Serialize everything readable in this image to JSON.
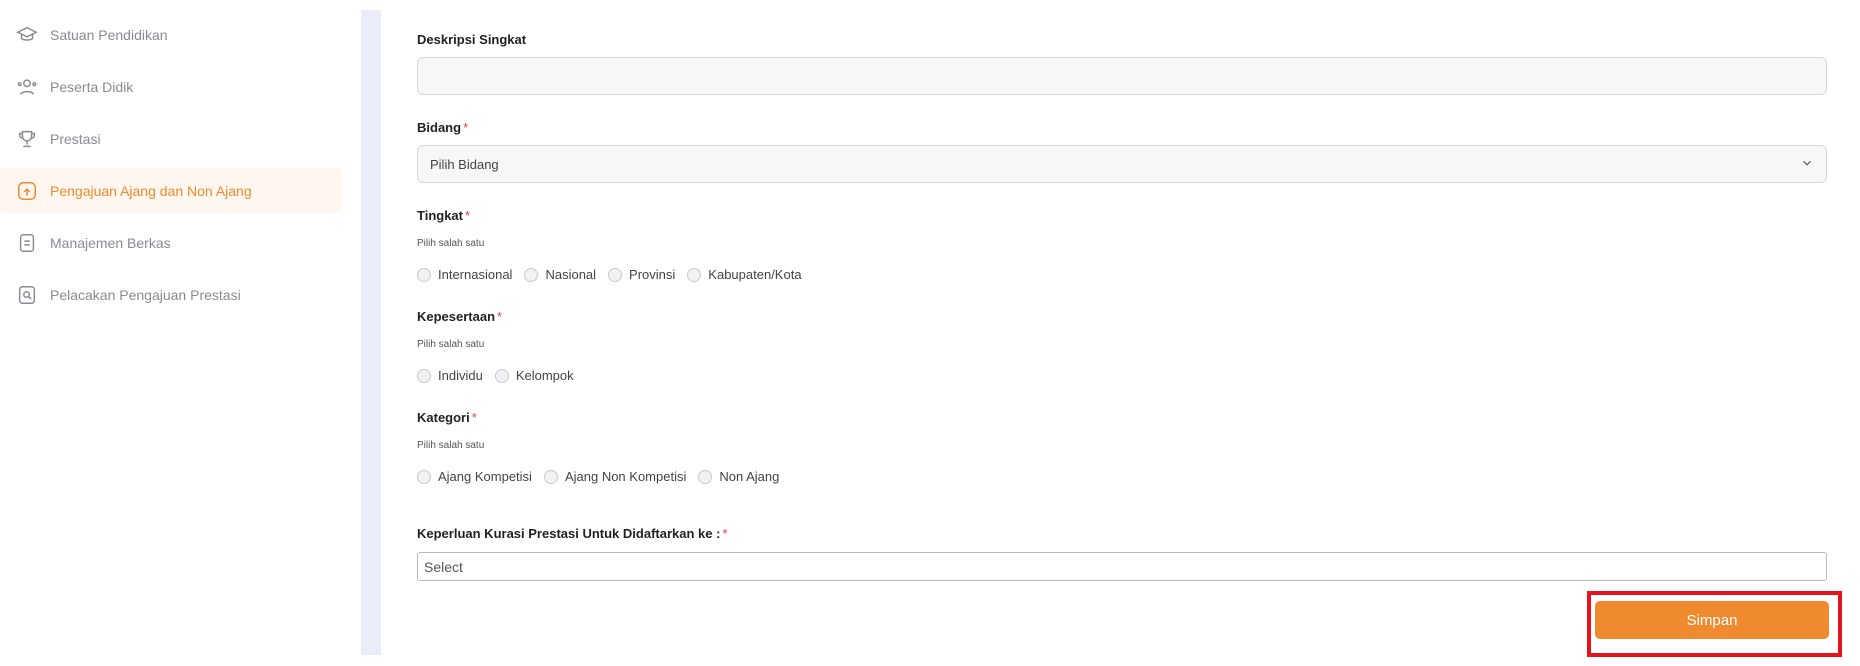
{
  "sidebar": {
    "items": [
      {
        "label": "Satuan Pendidikan",
        "icon": "graduation-cap-icon"
      },
      {
        "label": "Peserta Didik",
        "icon": "users-icon"
      },
      {
        "label": "Prestasi",
        "icon": "trophy-icon"
      },
      {
        "label": "Pengajuan Ajang dan Non Ajang",
        "icon": "document-submit-icon",
        "active": true
      },
      {
        "label": "Manajemen Berkas",
        "icon": "file-icon"
      },
      {
        "label": "Pelacakan Pengajuan Prestasi",
        "icon": "search-document-icon"
      }
    ]
  },
  "form": {
    "deskripsi": {
      "label": "Deskripsi Singkat",
      "value": ""
    },
    "bidang": {
      "label": "Bidang",
      "required": "*",
      "selected": "Pilih Bidang"
    },
    "tingkat": {
      "label": "Tingkat",
      "required": "*",
      "hint": "Pilih salah satu",
      "options": [
        "Internasional",
        "Nasional",
        "Provinsi",
        "Kabupaten/Kota"
      ]
    },
    "kepesertaan": {
      "label": "Kepesertaan",
      "required": "*",
      "hint": "Pilih salah satu",
      "options": [
        "Individu",
        "Kelompok"
      ]
    },
    "kategori": {
      "label": "Kategori",
      "required": "*",
      "hint": "Pilih salah satu",
      "options": [
        "Ajang Kompetisi",
        "Ajang Non Kompetisi",
        "Non Ajang"
      ]
    },
    "keperluan": {
      "label": "Keperluan Kurasi Prestasi Untuk Didaftarkan ke :",
      "required": "*",
      "placeholder": "Select"
    },
    "submit_label": "Simpan"
  },
  "colors": {
    "accent": "#f08a2f",
    "active_bg": "#fff6ef",
    "required": "#e53e3e",
    "highlight": "#e8121c"
  }
}
